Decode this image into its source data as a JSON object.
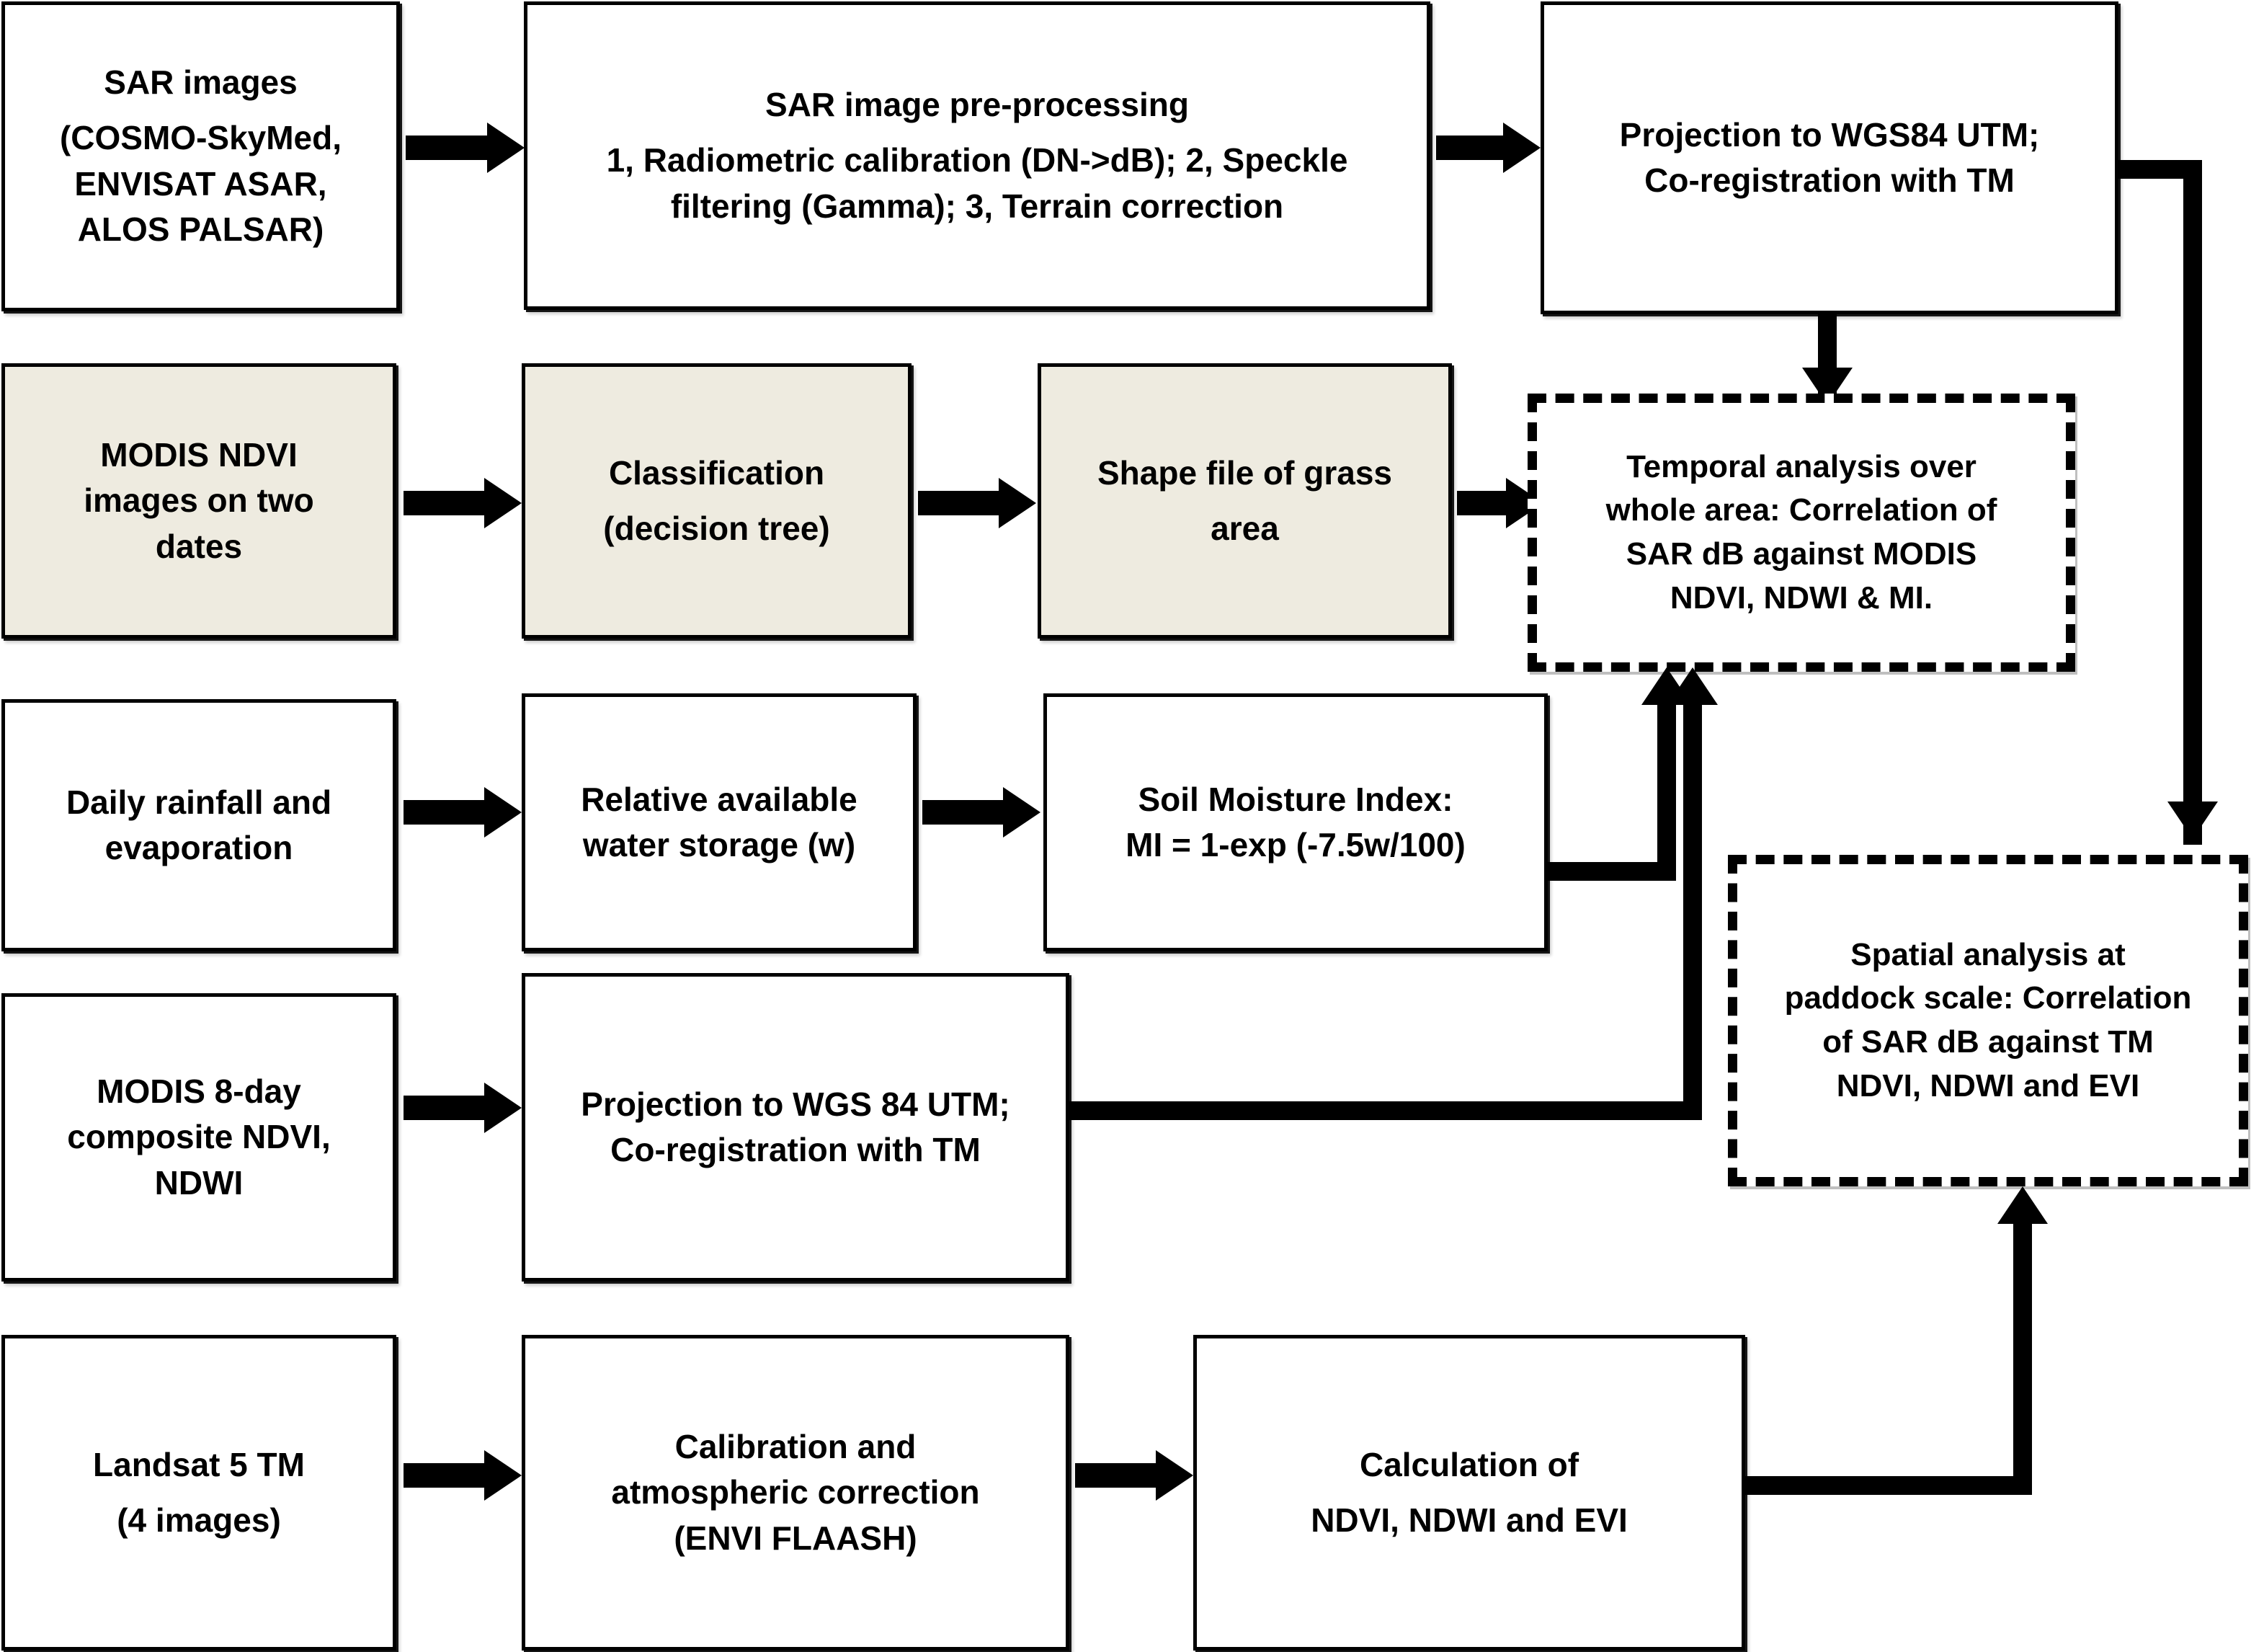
{
  "diagram": {
    "title": "SAR / MODIS / Landsat grassland remote-sensing processing flowchart",
    "colors": {
      "stroke": "#000000",
      "background": "#FFFFFF",
      "shaded_fill": "#EEEBE0"
    }
  },
  "nodes": {
    "sar_images": {
      "line1": "SAR images",
      "line2": "(COSMO-SkyMed,",
      "line3": "ENVISAT ASAR,",
      "line4": "ALOS PALSAR)"
    },
    "sar_preprocessing": {
      "line1": "SAR image pre-processing",
      "line2": "1, Radiometric calibration (DN->dB); 2, Speckle",
      "line3": "filtering (Gamma); 3, Terrain correction"
    },
    "projection_sar": {
      "line1": "Projection to WGS84 UTM;",
      "line2": "Co-registration with TM"
    },
    "modis_ndvi_two_dates": {
      "line1": "MODIS NDVI",
      "line2": "images on two",
      "line3": "dates"
    },
    "classification": {
      "line1": "Classification",
      "line2": "(decision tree)"
    },
    "shape_file_grass": {
      "line1": "Shape file of grass",
      "line2": "area"
    },
    "temporal_analysis": {
      "line1": "Temporal analysis over",
      "line2": "whole area: Correlation of",
      "line3": "SAR dB against MODIS",
      "line4": "NDVI, NDWI & MI."
    },
    "daily_rainfall": {
      "line1": "Daily rainfall and",
      "line2": "evaporation"
    },
    "water_storage": {
      "line1": "Relative available",
      "line2": "water storage (w)"
    },
    "soil_moisture_index": {
      "line1": "Soil Moisture Index:",
      "line2": "MI = 1-exp (-7.5w/100)"
    },
    "modis_8day": {
      "line1": "MODIS 8-day",
      "line2": "composite NDVI,",
      "line3": "NDWI"
    },
    "projection_modis": {
      "line1": "Projection to WGS 84 UTM;",
      "line2": "Co-registration with TM"
    },
    "spatial_analysis": {
      "line1": "Spatial analysis at",
      "line2": "paddock scale: Correlation",
      "line3": "of SAR dB against TM",
      "line4": "NDVI, NDWI and EVI"
    },
    "landsat5_tm": {
      "line1": "Landsat 5 TM",
      "line2": "(4 images)"
    },
    "calibration_atmos": {
      "line1": "Calibration and",
      "line2": "atmospheric correction",
      "line3": "(ENVI FLAASH)"
    },
    "calculation_indices": {
      "line1": "Calculation of",
      "line2": "NDVI, NDWI and EVI"
    }
  }
}
